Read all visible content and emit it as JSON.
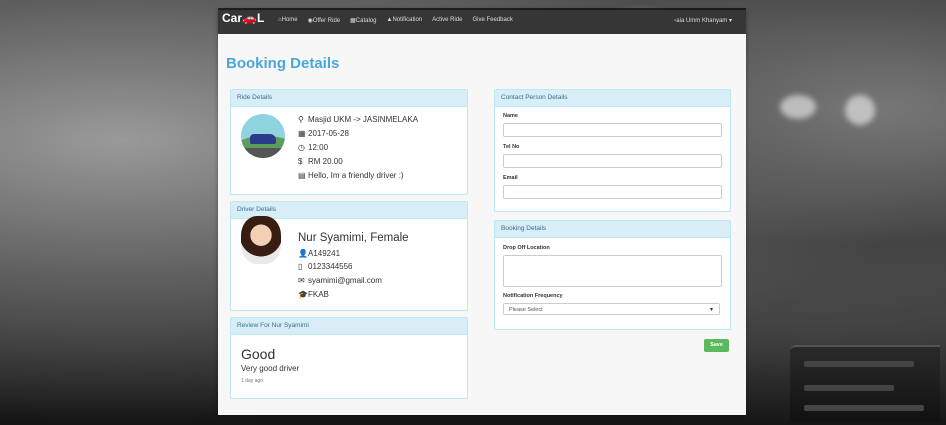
{
  "nav": {
    "logo_text": "Car",
    "logo_text_end": "L",
    "links": [
      {
        "icon": "home-icon",
        "label": "Home"
      },
      {
        "icon": "location-icon",
        "label": "Offer Ride"
      },
      {
        "icon": "grid-icon",
        "label": "Catalog"
      },
      {
        "icon": "bell-icon",
        "label": "Notification"
      },
      {
        "icon": "",
        "label": "Active Ride"
      },
      {
        "icon": "",
        "label": "Give Feedback"
      }
    ],
    "user": "aia Umm Khanyam"
  },
  "page_title": "Booking Details",
  "ride": {
    "header": "Ride Details",
    "route": "Masjid UKM -> JASINMELAKA",
    "date": "2017-05-28",
    "time": "12:00",
    "price": "RM 20.00",
    "note": "Hello, Im a friendly driver :)"
  },
  "driver": {
    "header": "Driver Details",
    "name": "Nur Syamimi, Female",
    "id": "A149241",
    "phone": "0123344556",
    "email": "syamimi@gmail.com",
    "faculty": "FKAB"
  },
  "review": {
    "header": "Review For Nur Syamimi",
    "rating": "Good",
    "text": "Very good driver",
    "time": "1 day ago"
  },
  "contact": {
    "header": "Contact Person Details",
    "name_label": "Name",
    "tel_label": "Tel No",
    "email_label": "Email"
  },
  "booking": {
    "header": "Booking Details",
    "dropoff_label": "Drop Off Location",
    "frequency_label": "Notification Frequency",
    "frequency_value": "Please Select",
    "save_label": "Save"
  },
  "colors": {
    "accent": "#4aa8d8",
    "panel_head": "#d9edf7",
    "save": "#5cb85c"
  }
}
